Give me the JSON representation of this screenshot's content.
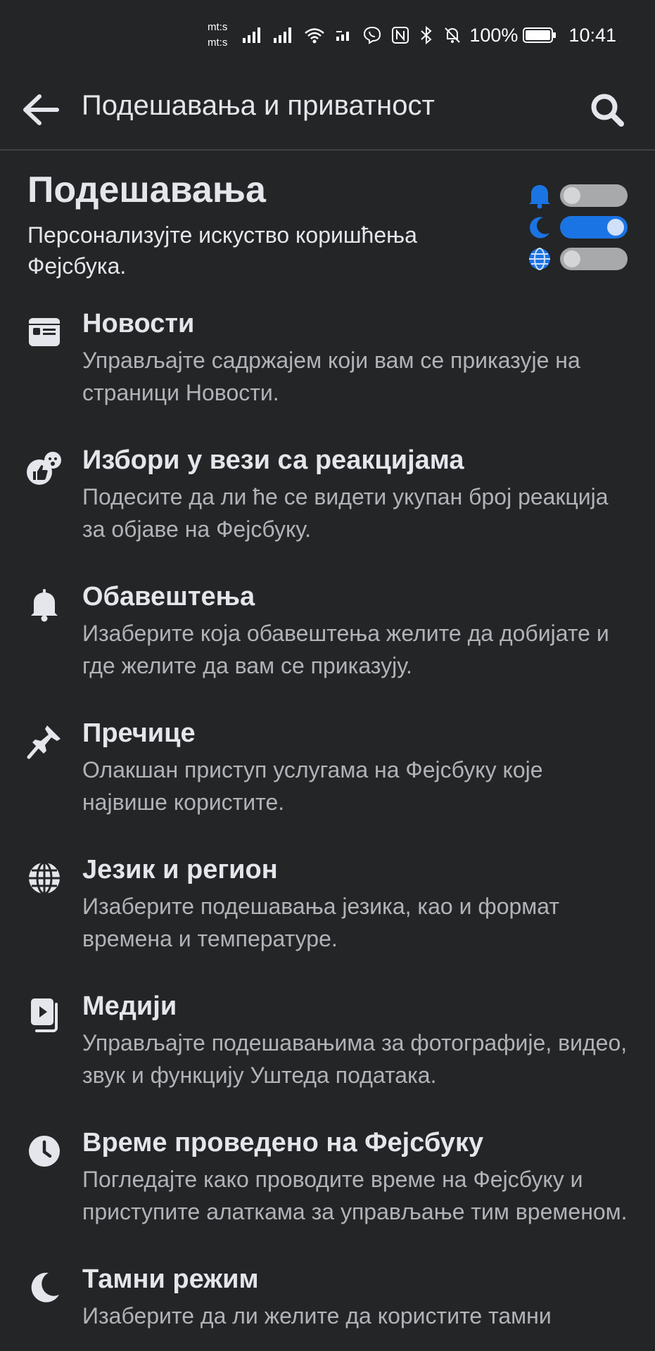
{
  "status_bar": {
    "carrier_1": "mt:s",
    "carrier_2": "mt:s",
    "battery": "100%",
    "time": "10:41"
  },
  "header": {
    "title": "Подешавања и приватност"
  },
  "section": {
    "title": "Подешавања",
    "subtitle": "Персонализујте искуство коришћења Фејсбука."
  },
  "colors": {
    "background": "#242526",
    "accent": "#1b74e4"
  },
  "items": [
    {
      "icon": "news-feed-icon",
      "title": "Новости",
      "description": "Управљајте садржајем који вам се приказује на страници Новости."
    },
    {
      "icon": "reactions-icon",
      "title": "Избори у вези са реакцијама",
      "description": "Подесите да ли ће се видети укупан број реакција за објаве на Фејсбуку."
    },
    {
      "icon": "bell-icon",
      "title": "Обавештења",
      "description": "Изаберите која обавештења желите да добијате и где желите да вам се приказују."
    },
    {
      "icon": "pin-icon",
      "title": "Пречице",
      "description": "Олакшан приступ услугама на Фејсбуку које највише користите."
    },
    {
      "icon": "globe-icon",
      "title": "Језик и регион",
      "description": "Изаберите подешавања језика, као и формат времена и температуре."
    },
    {
      "icon": "media-icon",
      "title": "Медији",
      "description": "Управљајте подешавањима за фотографије, видео, звук и функцију Уштеда података."
    },
    {
      "icon": "clock-icon",
      "title": "Време проведено на Фејсбуку",
      "description": "Погледајте како проводите време на Фејсбуку и приступите алаткама за управљање тим временом."
    },
    {
      "icon": "moon-icon",
      "title": "Тамни режим",
      "description": "Изаберите да ли желите да користите тамни"
    }
  ]
}
